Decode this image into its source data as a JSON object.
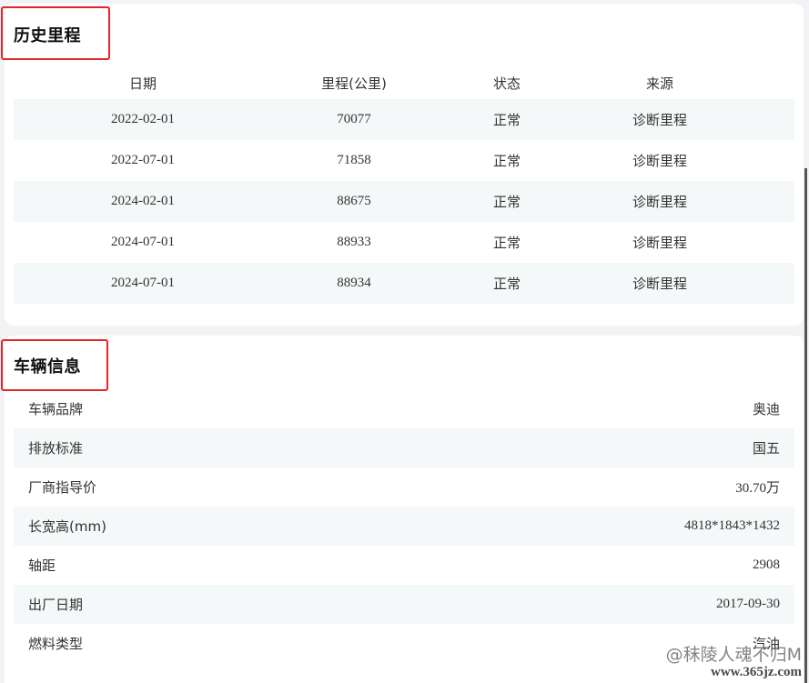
{
  "mileage_history": {
    "title": "历史里程",
    "columns": [
      "日期",
      "里程(公里)",
      "状态",
      "来源"
    ],
    "rows": [
      {
        "date": "2022-02-01",
        "km": "70077",
        "status": "正常",
        "source": "诊断里程"
      },
      {
        "date": "2022-07-01",
        "km": "71858",
        "status": "正常",
        "source": "诊断里程"
      },
      {
        "date": "2024-02-01",
        "km": "88675",
        "status": "正常",
        "source": "诊断里程"
      },
      {
        "date": "2024-07-01",
        "km": "88933",
        "status": "正常",
        "source": "诊断里程"
      },
      {
        "date": "2024-07-01",
        "km": "88934",
        "status": "正常",
        "source": "诊断里程"
      }
    ]
  },
  "vehicle_info": {
    "title": "车辆信息",
    "rows": [
      {
        "label": "车辆品牌",
        "value": "奥迪"
      },
      {
        "label": "排放标准",
        "value": "国五"
      },
      {
        "label": "厂商指导价",
        "value": "30.70万"
      },
      {
        "label": "长宽高(mm)",
        "value": "4818*1843*1432"
      },
      {
        "label": "轴距",
        "value": "2908"
      },
      {
        "label": "出厂日期",
        "value": "2017-09-30"
      },
      {
        "label": "燃料类型",
        "value": "汽油"
      }
    ]
  },
  "watermark": {
    "line1": "@秣陵人魂不归M",
    "line2": "www.365jz.com"
  },
  "colors": {
    "highlight_box": "#e5252a",
    "row_alt": "#f4f8f8",
    "page_bg": "#f2f3f5"
  }
}
